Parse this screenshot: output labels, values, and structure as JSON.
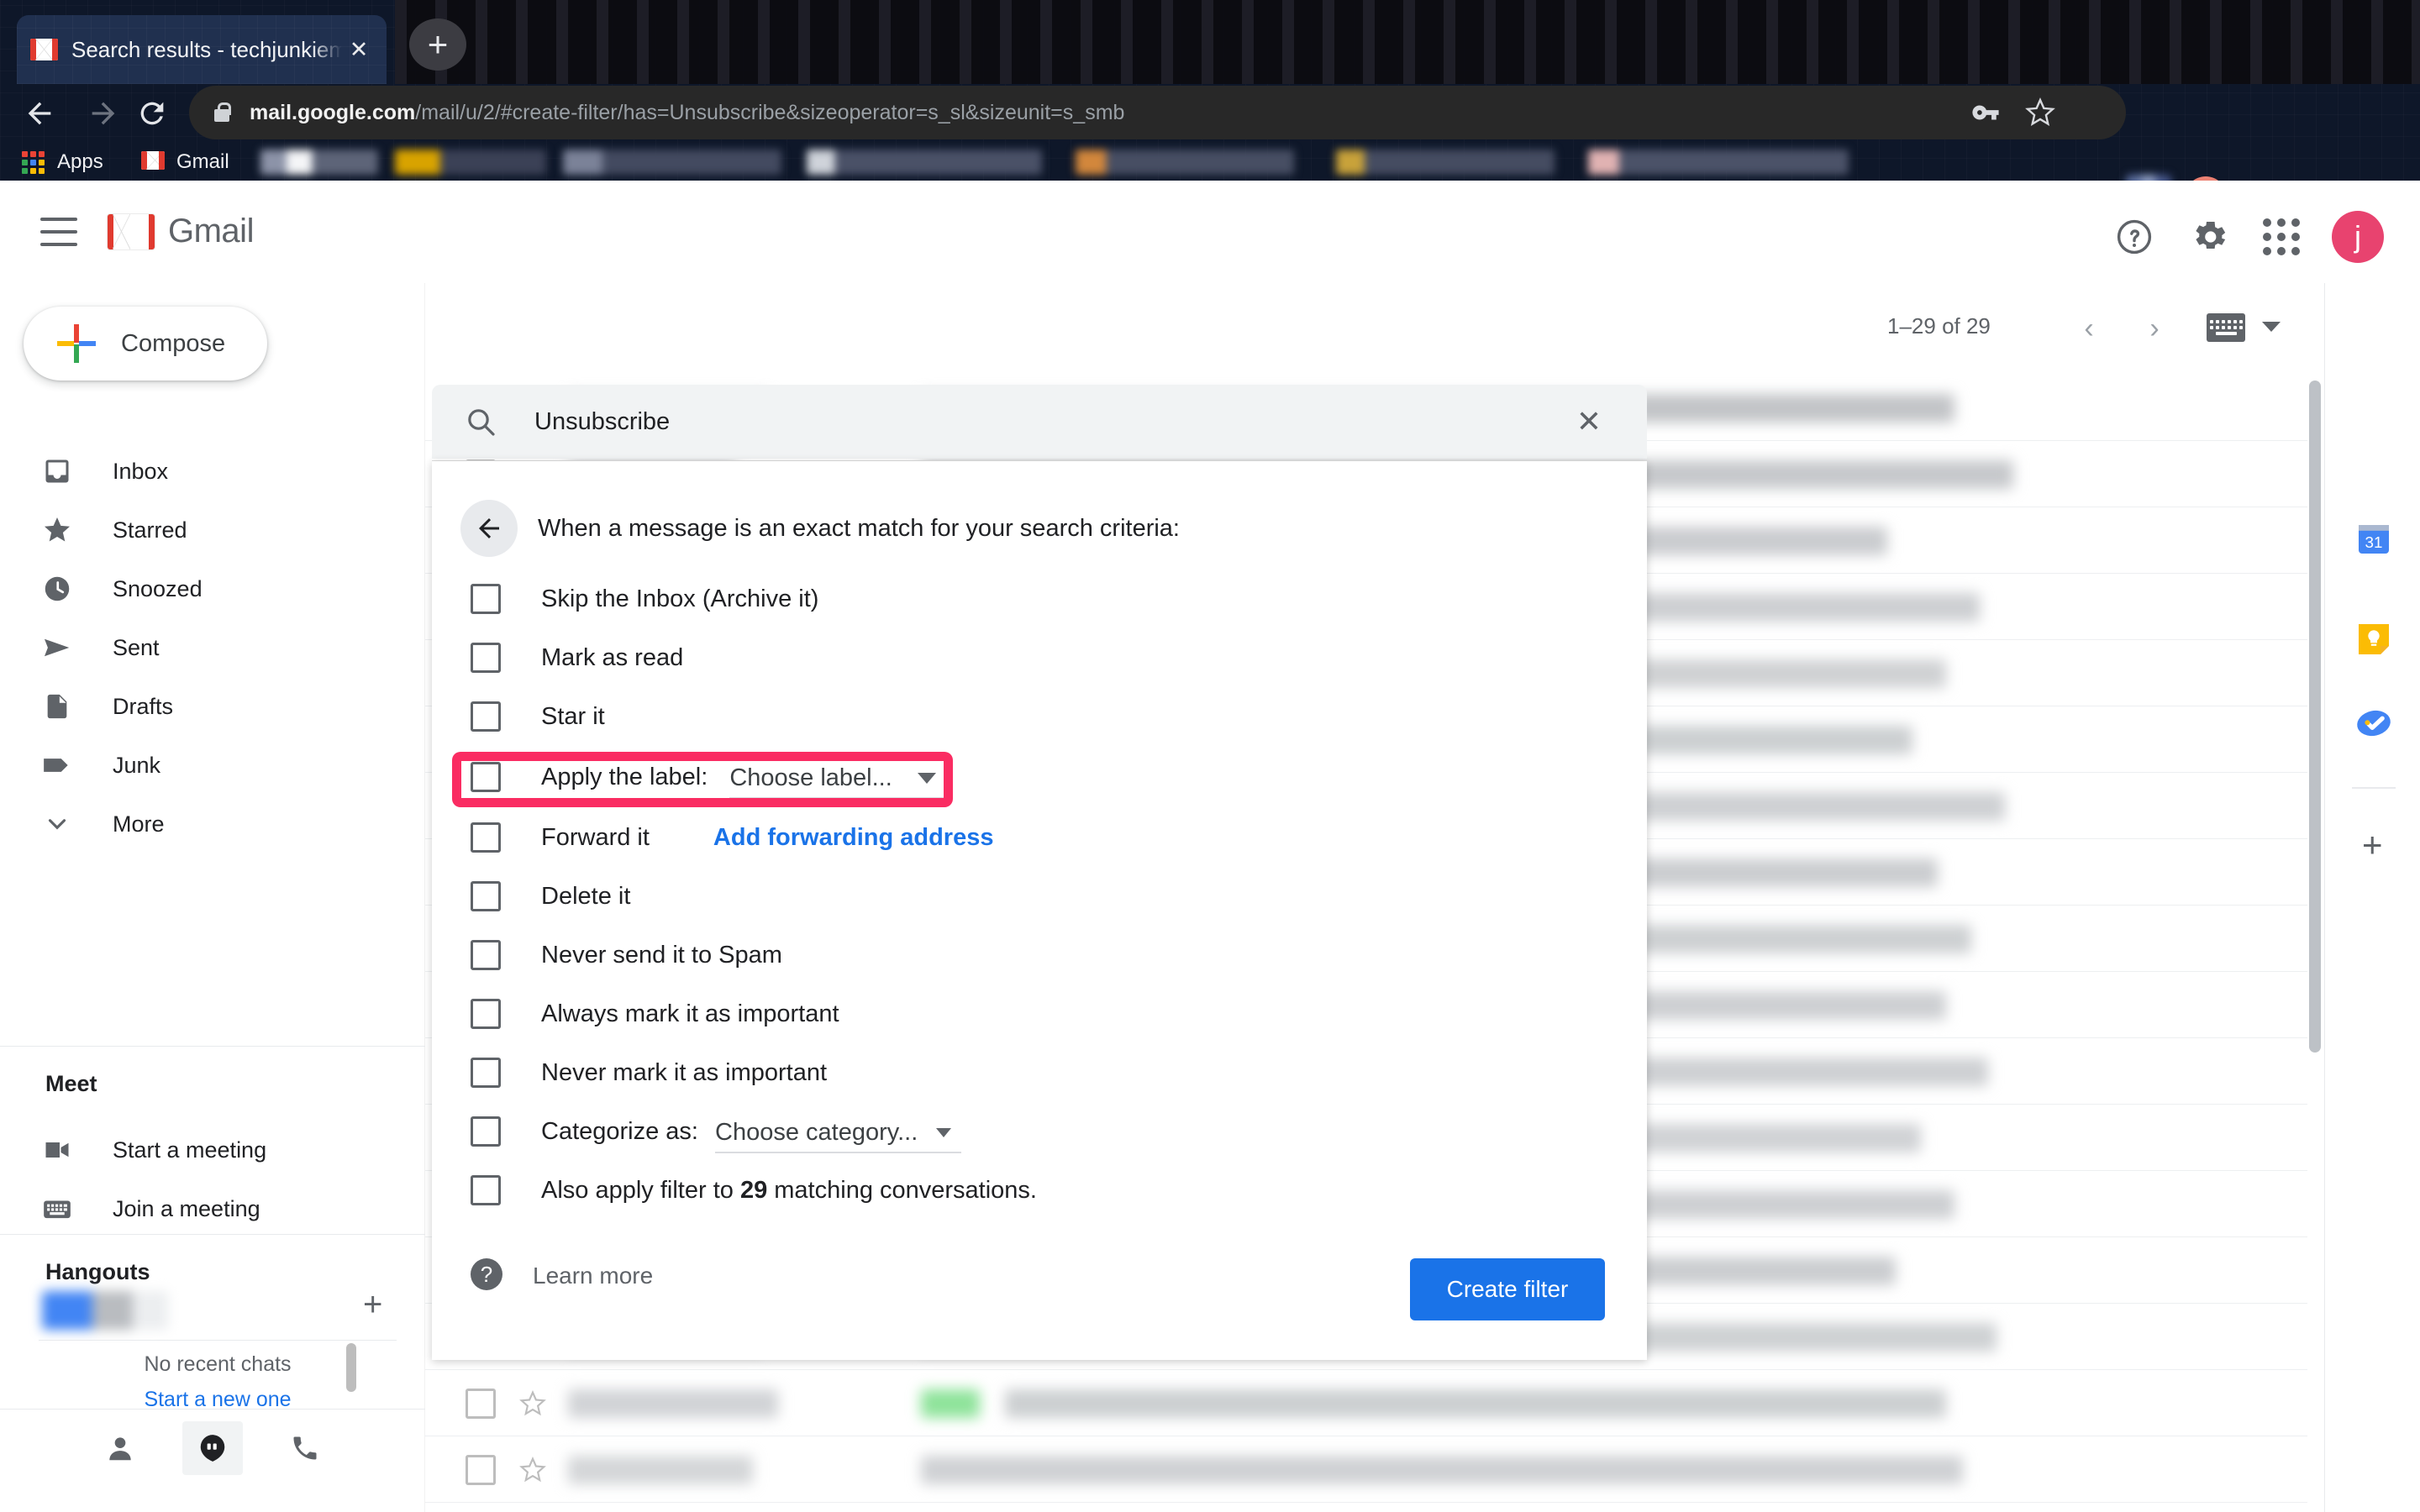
{
  "browser": {
    "tab": {
      "title": "Search results - techjunkiemail",
      "close_label": "✕"
    },
    "new_tab_label": "+",
    "url": {
      "host": "mail.google.com",
      "path": "/mail/u/2/#create-filter/has=Unsubscribe&sizeoperator=s_sl&sizeunit=s_smb"
    },
    "bookmarks": {
      "apps_label": "Apps",
      "gmail_label": "Gmail"
    }
  },
  "gmail": {
    "wordmark": "Gmail",
    "compose_label": "Compose",
    "nav_items": [
      {
        "label": "Inbox",
        "icon": "inbox-icon"
      },
      {
        "label": "Starred",
        "icon": "star-icon"
      },
      {
        "label": "Snoozed",
        "icon": "clock-icon"
      },
      {
        "label": "Sent",
        "icon": "send-icon"
      },
      {
        "label": "Drafts",
        "icon": "document-icon"
      },
      {
        "label": "Junk",
        "icon": "label-icon"
      },
      {
        "label": "More",
        "icon": "chevron-down-icon"
      }
    ],
    "meet": {
      "heading": "Meet",
      "items": [
        {
          "label": "Start a meeting",
          "icon": "video-camera-icon"
        },
        {
          "label": "Join a meeting",
          "icon": "keyboard-icon"
        }
      ]
    },
    "hangouts": {
      "heading": "Hangouts",
      "no_recent_chats": "No recent chats",
      "start_new": "Start a new one",
      "add_label": "+"
    },
    "toolbar": {
      "pagination": "1–29 of 29",
      "prev_label": "‹",
      "next_label": "›"
    },
    "account_initial": "j"
  },
  "search": {
    "value": "Unsubscribe",
    "clear_label": "✕"
  },
  "filter_dialog": {
    "heading": "When a message is an exact match for your search criteria:",
    "options": [
      {
        "label": "Skip the Inbox (Archive it)",
        "checked": false
      },
      {
        "label": "Mark as read",
        "checked": false
      },
      {
        "label": "Star it",
        "checked": false
      },
      {
        "label": "Apply the label:",
        "checked": false,
        "dropdown": "Choose label...",
        "highlighted": true
      },
      {
        "label": "Forward it",
        "checked": false,
        "link": "Add forwarding address"
      },
      {
        "label": "Delete it",
        "checked": false
      },
      {
        "label": "Never send it to Spam",
        "checked": false
      },
      {
        "label": "Always mark it as important",
        "checked": false
      },
      {
        "label": "Never mark it as important",
        "checked": false
      },
      {
        "label": "Categorize as:",
        "checked": false,
        "dropdown": "Choose category..."
      }
    ],
    "also_apply": {
      "prefix": "Also apply filter to ",
      "count": "29",
      "suffix": " matching conversations."
    },
    "learn_more": "Learn more",
    "create_filter_label": "Create filter",
    "highlight_color": "#fa2c62"
  },
  "side_panel": {
    "apps": [
      {
        "name": "calendar-icon",
        "label": "31"
      },
      {
        "name": "keep-icon",
        "label": ""
      },
      {
        "name": "tasks-icon",
        "label": ""
      }
    ],
    "add_label": "+"
  }
}
